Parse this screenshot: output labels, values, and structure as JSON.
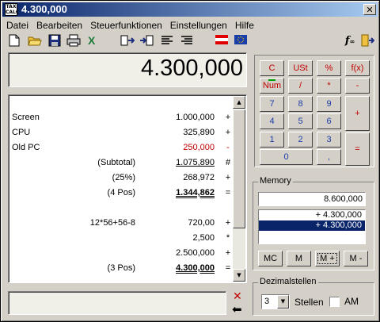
{
  "window": {
    "title": "4.300,000",
    "app_icon_text": "TAX CALC"
  },
  "menu": [
    "Datei",
    "Bearbeiten",
    "Steuerfunktionen",
    "Einstellungen",
    "Hilfe"
  ],
  "toolbar_icons": [
    "new-file-icon",
    "open-folder-icon",
    "save-icon",
    "print-icon",
    "excel-icon",
    "paste-left-icon",
    "paste-right-icon",
    "align-left-icon",
    "align-right-icon",
    "austria-flag-icon",
    "eu-flag-icon",
    "function-icon",
    "exit-icon"
  ],
  "display": {
    "value": "4.300,000"
  },
  "tape": [
    {
      "label": "Screen",
      "value": "1.000,000",
      "op": "+",
      "style": ""
    },
    {
      "label": "CPU",
      "value": "325,890",
      "op": "+",
      "style": ""
    },
    {
      "label": "Old PC",
      "value": "250,000",
      "op": "-",
      "style": "red"
    },
    {
      "label": "(Subtotal)",
      "value": "1.075,890",
      "op": "#",
      "style": "ul",
      "mid": true
    },
    {
      "label": "(25%)",
      "value": "268,972",
      "op": "+",
      "style": "",
      "mid": true
    },
    {
      "label": "(4 Pos)",
      "value": "1.344,862",
      "op": "=",
      "style": "bold dul",
      "mid": true
    },
    {
      "label": "",
      "value": "",
      "op": "",
      "style": ""
    },
    {
      "label": "12*56+56-8",
      "value": "720,00",
      "op": "+",
      "style": "",
      "mid": true
    },
    {
      "label": "",
      "value": "2,500",
      "op": "*",
      "style": ""
    },
    {
      "label": "",
      "value": "2.500,000",
      "op": "+",
      "style": ""
    },
    {
      "label": "(3 Pos)",
      "value": "4.300,000",
      "op": "=",
      "style": "bold dul",
      "mid": true
    }
  ],
  "keypad": {
    "row1": [
      "C",
      "USt",
      "%",
      "f(x)"
    ],
    "row2": [
      "Num",
      "/",
      "*",
      "-"
    ],
    "digits": [
      "7",
      "8",
      "9",
      "4",
      "5",
      "6",
      "1",
      "2",
      "3",
      "0",
      ","
    ],
    "plus": "+",
    "equals": "="
  },
  "memory": {
    "label": "Memory",
    "value": "8.600,000",
    "items": [
      "+ 4.300,000",
      "+ 4.300,000"
    ],
    "selected_index": 1,
    "buttons": [
      "MC",
      "M",
      "M +",
      "M -"
    ]
  },
  "dezimal": {
    "label": "Dezimalstellen",
    "value": "3",
    "stellen_label": "Stellen",
    "am_label": "AM",
    "am_checked": false
  },
  "colors": {
    "accent_red": "#c00000",
    "digit_blue": "#1a3ea8",
    "title_blue": "#0a246a"
  }
}
